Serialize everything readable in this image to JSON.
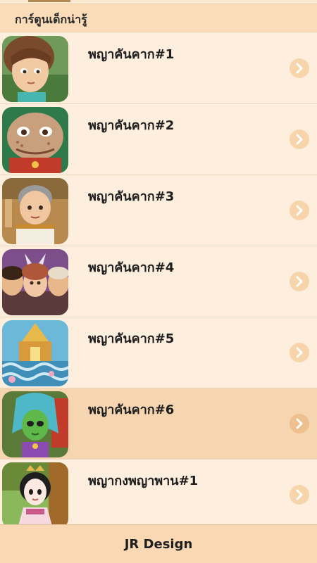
{
  "header": {
    "title": "การ์ตูนเด็กน่ารู้"
  },
  "list": {
    "items": [
      {
        "label": "พญาคันคาก#1",
        "icon": "chevron-right-icon"
      },
      {
        "label": "พญาคันคาก#2",
        "icon": "chevron-right-icon"
      },
      {
        "label": "พญาคันคาก#3",
        "icon": "chevron-right-icon"
      },
      {
        "label": "พญาคันคาก#4",
        "icon": "chevron-right-icon"
      },
      {
        "label": "พญาคันคาก#5",
        "icon": "chevron-right-icon"
      },
      {
        "label": "พญาคันคาก#6",
        "icon": "chevron-right-icon",
        "selected": true
      },
      {
        "label": "พญากงพญาพาน#1",
        "icon": "chevron-right-icon"
      }
    ]
  },
  "footer": {
    "label": "JR Design"
  },
  "colors": {
    "background": "#fcefdf",
    "header": "#fadcb8",
    "selected_row": "#f5d6b0",
    "footer": "#f9d8b3"
  }
}
